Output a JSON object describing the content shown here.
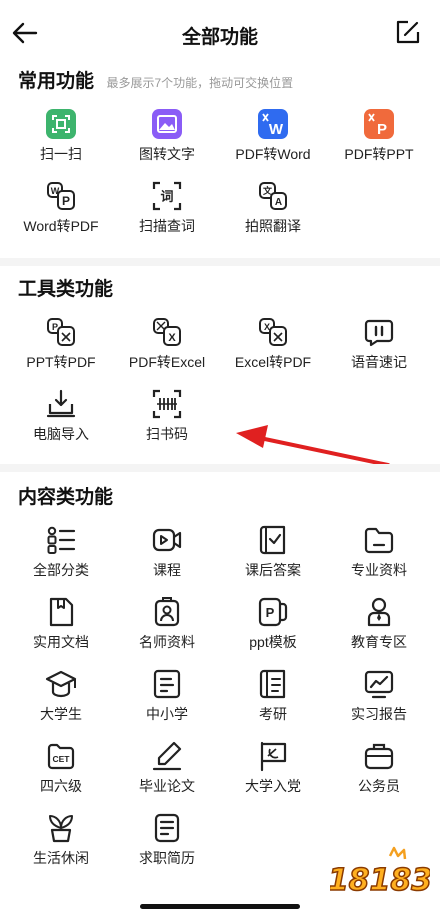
{
  "header": {
    "title": "全部功能",
    "back_icon": "back-arrow-icon",
    "edit_icon": "edit-icon"
  },
  "sections": [
    {
      "title": "常用功能",
      "subtitle": "最多展示7个功能，拖动可交换位置",
      "items": [
        {
          "label": "扫一扫",
          "icon": "scan-icon",
          "color": "#3db46d"
        },
        {
          "label": "图转文字",
          "icon": "image-to-text-icon",
          "color": "#8a5cf6"
        },
        {
          "label": "PDF转Word",
          "icon": "pdf-to-word-icon",
          "color": "#2f6bf0"
        },
        {
          "label": "PDF转PPT",
          "icon": "pdf-to-ppt-icon",
          "color": "#f06a3c"
        },
        {
          "label": "Word转PDF",
          "icon": "word-to-pdf-icon"
        },
        {
          "label": "扫描查词",
          "icon": "scan-word-icon"
        },
        {
          "label": "拍照翻译",
          "icon": "photo-translate-icon"
        }
      ]
    },
    {
      "title": "工具类功能",
      "items": [
        {
          "label": "PPT转PDF",
          "icon": "ppt-to-pdf-icon"
        },
        {
          "label": "PDF转Excel",
          "icon": "pdf-to-excel-icon"
        },
        {
          "label": "Excel转PDF",
          "icon": "excel-to-pdf-icon"
        },
        {
          "label": "语音速记",
          "icon": "voice-note-icon"
        },
        {
          "label": "电脑导入",
          "icon": "computer-import-icon"
        },
        {
          "label": "扫书码",
          "icon": "scan-book-code-icon"
        }
      ]
    },
    {
      "title": "内容类功能",
      "items": [
        {
          "label": "全部分类",
          "icon": "category-list-icon"
        },
        {
          "label": "课程",
          "icon": "course-video-icon"
        },
        {
          "label": "课后答案",
          "icon": "answer-book-icon"
        },
        {
          "label": "专业资料",
          "icon": "folder-icon"
        },
        {
          "label": "实用文档",
          "icon": "document-icon"
        },
        {
          "label": "名师资料",
          "icon": "teacher-badge-icon"
        },
        {
          "label": "ppt模板",
          "icon": "ppt-template-icon"
        },
        {
          "label": "教育专区",
          "icon": "education-icon"
        },
        {
          "label": "大学生",
          "icon": "graduation-cap-icon"
        },
        {
          "label": "中小学",
          "icon": "school-doc-icon"
        },
        {
          "label": "考研",
          "icon": "exam-book-icon"
        },
        {
          "label": "实习报告",
          "icon": "report-chart-icon"
        },
        {
          "label": "四六级",
          "icon": "cet-icon"
        },
        {
          "label": "毕业论文",
          "icon": "thesis-pen-icon"
        },
        {
          "label": "大学入党",
          "icon": "party-flag-icon"
        },
        {
          "label": "公务员",
          "icon": "civil-servant-icon"
        },
        {
          "label": "生活休闲",
          "icon": "plant-pot-icon"
        },
        {
          "label": "求职简历",
          "icon": "resume-icon"
        }
      ]
    }
  ],
  "annotation": {
    "icon": "red-arrow-icon",
    "color": "#e02020"
  },
  "watermark": {
    "text": "18183",
    "icon": "watermark-logo"
  }
}
